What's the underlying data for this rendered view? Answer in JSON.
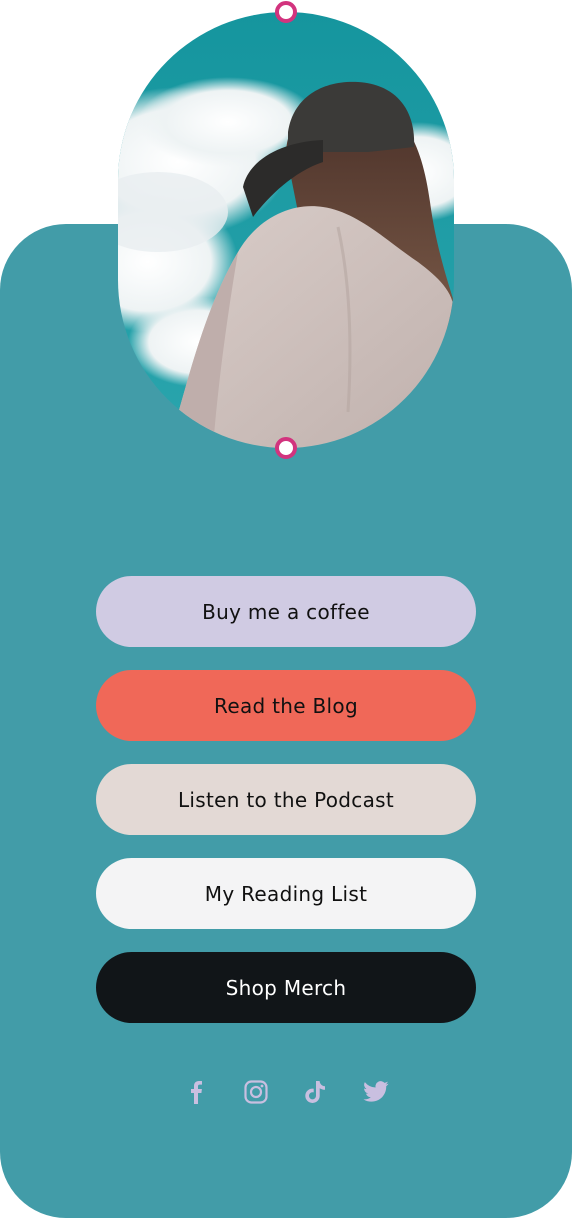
{
  "colors": {
    "page_background": "#ffffff",
    "card_background": "#429ca8",
    "pin_accent": "#d2337e",
    "social_icon": "#c9bfe0"
  },
  "profile": {
    "photo_icon": "profile-photo"
  },
  "links": [
    {
      "label": "Buy me a coffee",
      "bg": "#d0cbe3",
      "fg": "#111111"
    },
    {
      "label": "Read the Blog",
      "bg": "#f06858",
      "fg": "#111111"
    },
    {
      "label": "Listen to the Podcast",
      "bg": "#e3d9d5",
      "fg": "#111111"
    },
    {
      "label": "My Reading List",
      "bg": "#f4f4f5",
      "fg": "#111111"
    },
    {
      "label": "Shop Merch",
      "bg": "#111518",
      "fg": "#ffffff"
    }
  ],
  "social": [
    {
      "icon": "facebook-icon"
    },
    {
      "icon": "instagram-icon"
    },
    {
      "icon": "tiktok-icon"
    },
    {
      "icon": "twitter-icon"
    }
  ]
}
